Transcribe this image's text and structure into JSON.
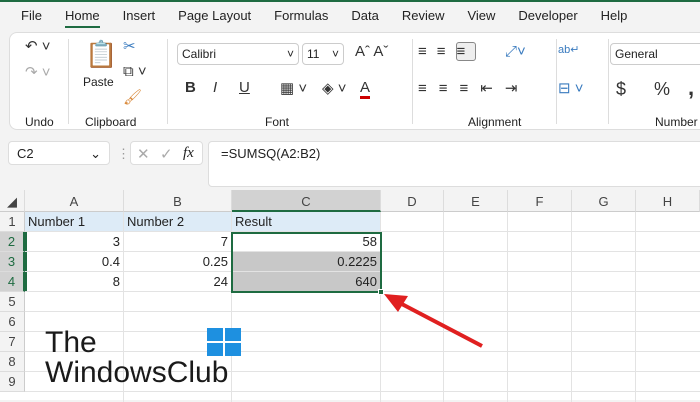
{
  "tabs": [
    "File",
    "Home",
    "Insert",
    "Page Layout",
    "Formulas",
    "Data",
    "Review",
    "View",
    "Developer",
    "Help"
  ],
  "ribbon": {
    "groups": {
      "undo": "Undo",
      "clipboard": "Clipboard",
      "font": "Font",
      "alignment": "Alignment",
      "number": "Number"
    },
    "paste": "Paste",
    "font_name": "Calibri",
    "font_size": "11",
    "number_format": "General",
    "bold": "B",
    "italic": "I",
    "underline": "U",
    "dollar": "$",
    "percent": "%",
    "comma": ","
  },
  "formula_bar": {
    "name_box": "C2",
    "fx": "fx",
    "formula": "=SUMSQ(A2:B2)"
  },
  "columns": [
    "A",
    "B",
    "C",
    "D",
    "E",
    "F",
    "G",
    "H"
  ],
  "rows": [
    "1",
    "2",
    "3",
    "4",
    "5",
    "6",
    "7",
    "8",
    "9"
  ],
  "cells": {
    "A1": "Number 1",
    "B1": "Number 2",
    "C1": "Result",
    "A2": "3",
    "B2": "7",
    "C2": "58",
    "A3": "0.4",
    "B3": "0.25",
    "C3": "0.2225",
    "A4": "8",
    "B4": "24",
    "C4": "640"
  },
  "watermark": {
    "line1": "The",
    "line2": "WindowsClub"
  },
  "colors": {
    "accent": "#1e6b41",
    "arrow": "#e02020",
    "header_fill": "#ddebf7"
  }
}
